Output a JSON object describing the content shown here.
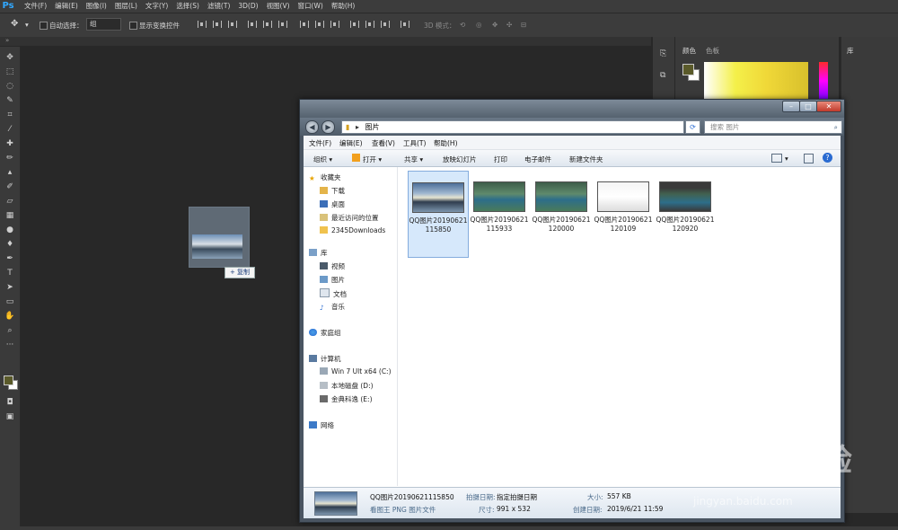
{
  "ps": {
    "logo": "Ps",
    "menu": [
      "文件(F)",
      "编辑(E)",
      "图像(I)",
      "图层(L)",
      "文字(Y)",
      "选择(S)",
      "滤镜(T)",
      "3D(D)",
      "视图(V)",
      "窗口(W)",
      "帮助(H)"
    ],
    "options": {
      "auto_select_label": "自动选择：",
      "auto_select_value": "组",
      "show_transform_label": "显示变换控件",
      "mode_3d_label": "3D 模式："
    },
    "panels": {
      "color_tab": "颜色",
      "swatches_tab": "色板",
      "library_tab": "库"
    },
    "fg_color": "#5a5a2a",
    "bg_color": "#ffffff"
  },
  "drag": {
    "copy_label": "+ 复制"
  },
  "explorer": {
    "address": "图片",
    "search_placeholder": "搜索 图片",
    "menu": [
      "文件(F)",
      "编辑(E)",
      "查看(V)",
      "工具(T)",
      "帮助(H)"
    ],
    "commands": [
      "组织 ▾",
      "打开 ▾",
      "共享 ▾",
      "放映幻灯片",
      "打印",
      "电子邮件",
      "新建文件夹"
    ],
    "nav": [
      {
        "label": "收藏夹",
        "icon": "star-icon"
      },
      {
        "label": "下载",
        "icon": "download-folder-icon"
      },
      {
        "label": "桌面",
        "icon": "desktop-icon"
      },
      {
        "label": "最近访问的位置",
        "icon": "recent-places-icon"
      },
      {
        "label": "2345Downloads",
        "icon": "folder-icon"
      },
      {
        "label": "库",
        "icon": "library-icon"
      },
      {
        "label": "视频",
        "icon": "video-icon"
      },
      {
        "label": "图片",
        "icon": "pictures-icon"
      },
      {
        "label": "文档",
        "icon": "documents-icon"
      },
      {
        "label": "音乐",
        "icon": "music-icon"
      },
      {
        "label": "家庭组",
        "icon": "homegroup-icon"
      },
      {
        "label": "计算机",
        "icon": "computer-icon"
      },
      {
        "label": "Win 7 Ult x64 (C:)",
        "icon": "drive-icon"
      },
      {
        "label": "本地磁盘 (D:)",
        "icon": "drive-icon"
      },
      {
        "label": "金典科逸 (E:)",
        "icon": "drive-icon"
      },
      {
        "label": "网络",
        "icon": "network-icon"
      }
    ],
    "files": [
      {
        "name": "QQ图片20190621115850",
        "selected": true
      },
      {
        "name": "QQ图片20190621115933",
        "selected": false
      },
      {
        "name": "QQ图片20190621120000",
        "selected": false
      },
      {
        "name": "QQ图片20190621120109",
        "selected": false
      },
      {
        "name": "QQ图片20190621120920",
        "selected": false
      }
    ],
    "details": {
      "filename": "QQ图片20190621115850",
      "type": "看图王 PNG 图片文件",
      "date_taken_label": "拍摄日期:",
      "date_taken_value": "指定拍摄日期",
      "dimensions_label": "尺寸:",
      "dimensions_value": "991 x 532",
      "size_label": "大小:",
      "size_value": "557 KB",
      "created_label": "创建日期:",
      "created_value": "2019/6/21 11:59"
    }
  },
  "watermark": {
    "brand": "Baidu 经验",
    "url": "jingyan.baidu.com"
  }
}
